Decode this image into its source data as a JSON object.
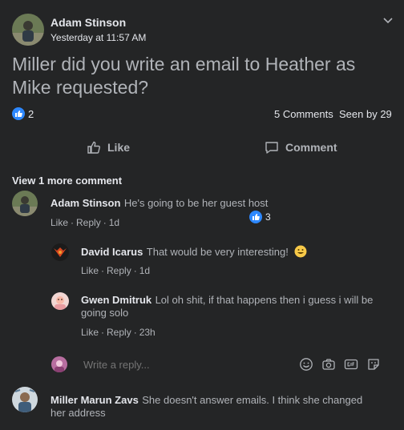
{
  "post": {
    "author": "Adam Stinson",
    "timestamp": "Yesterday at 11:57 AM",
    "text": "Miller did you write an email to Heather as Mike requested?",
    "like_count": "2",
    "comments_count": "5 Comments",
    "seen_by": "Seen by 29"
  },
  "actions": {
    "like": "Like",
    "comment": "Comment"
  },
  "view_more": "View 1 more comment",
  "comments": [
    {
      "author": "Adam Stinson",
      "text": "He's going to be her guest host",
      "like": "Like",
      "reply": "Reply",
      "time": "1d",
      "reactions": "3"
    },
    {
      "author": "David Icarus",
      "text": "That would be very interesting!",
      "like": "Like",
      "reply": "Reply",
      "time": "1d"
    },
    {
      "author": "Gwen Dmitruk",
      "text": "Lol oh shit, if that happens then i guess i will be going solo",
      "like": "Like",
      "reply": "Reply",
      "time": "23h"
    },
    {
      "author": "Miller Marun Zavs",
      "text": "She doesn't answer emails. I think she changed her address"
    }
  ],
  "reply_input": {
    "placeholder": "Write a reply..."
  },
  "colors": {
    "background": "#242526",
    "accent": "#2d88ff",
    "text": "#e4e6eb",
    "muted": "#b0b3b8"
  },
  "icons": [
    "chevron-down-icon",
    "like-thumb-icon",
    "comment-bubble-icon",
    "emoji-icon",
    "camera-icon",
    "gif-icon",
    "sticker-icon"
  ]
}
